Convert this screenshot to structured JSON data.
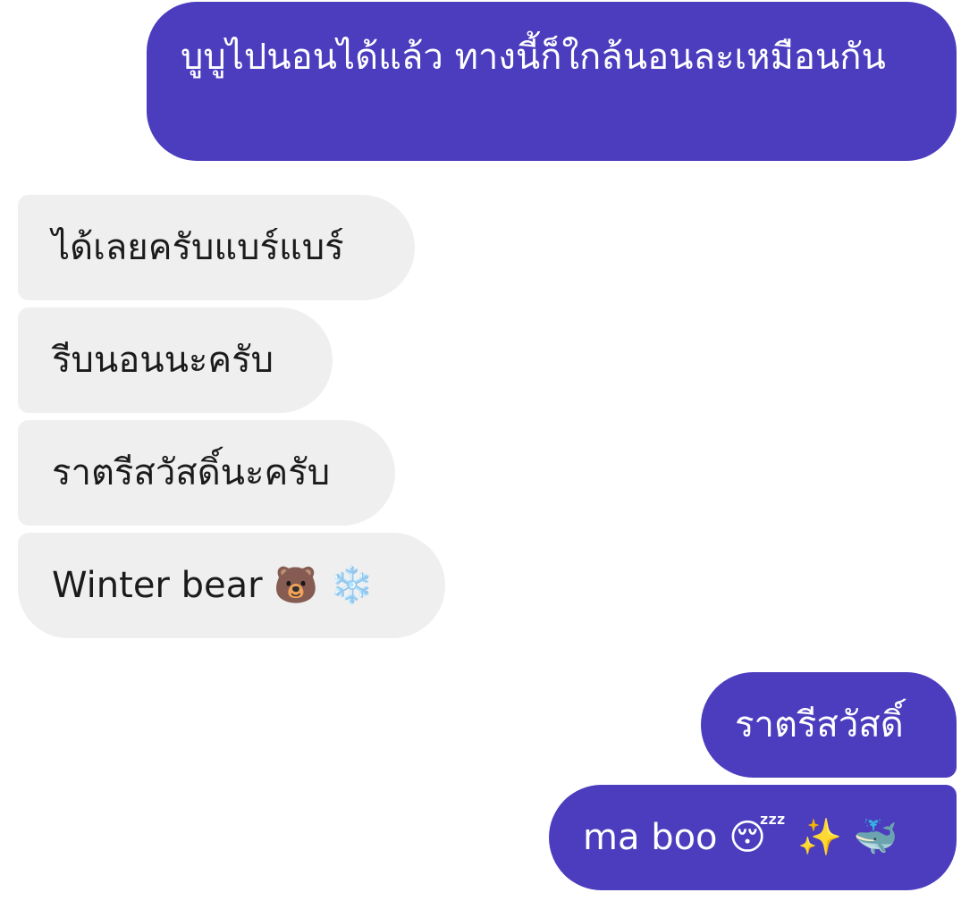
{
  "conversation": {
    "messages": [
      {
        "sender": "self",
        "text": "บูบูไปนอนได้แล้ว ทางนี้ก็ใกล้นอนละเหมือนกัน"
      },
      {
        "sender": "other",
        "text": "ได้เลยครับแบร์แบร์"
      },
      {
        "sender": "other",
        "text": "รีบนอนนะครับ"
      },
      {
        "sender": "other",
        "text": "ราตรีสวัสดิ์นะครับ"
      },
      {
        "sender": "other",
        "text": "Winter bear 🐻 ❄️"
      },
      {
        "sender": "self",
        "text": "ราตรีสวัสดิ์"
      },
      {
        "sender": "self",
        "text": "ma boo 😴 ✨ 🐳"
      }
    ]
  },
  "colors": {
    "sent_bubble": "#4b3dbe",
    "received_bubble": "#efefef",
    "sent_text": "#ffffff",
    "received_text": "#1b1b1b",
    "background": "#ffffff"
  }
}
